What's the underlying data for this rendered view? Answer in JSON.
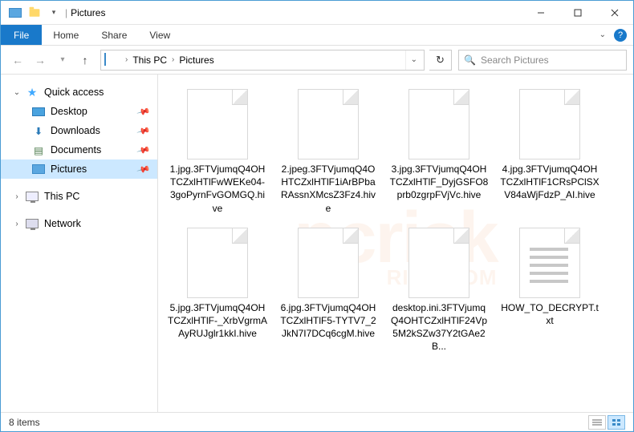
{
  "titlebar": {
    "title": "Pictures"
  },
  "menu": {
    "file": "File",
    "home": "Home",
    "share": "Share",
    "view": "View"
  },
  "breadcrumb": {
    "seg1": "This PC",
    "seg2": "Pictures"
  },
  "search": {
    "placeholder": "Search Pictures"
  },
  "sidebar": {
    "quick_access": "Quick access",
    "desktop": "Desktop",
    "downloads": "Downloads",
    "documents": "Documents",
    "pictures": "Pictures",
    "this_pc": "This PC",
    "network": "Network"
  },
  "files": {
    "f1": "1.jpg.3FTVjumqQ4OHTCZxlHTlFwWEKe04-3goPyrnFvGOMGQ.hive",
    "f2": "2.jpeg.3FTVjumqQ4OHTCZxlHTlF1iArBPbaRAssnXMcsZ3Fz4.hive",
    "f3": "3.jpg.3FTVjumqQ4OHTCZxlHTlF_DyjGSFO8prb0zgrpFVjVc.hive",
    "f4": "4.jpg.3FTVjumqQ4OHTCZxlHTlF1CRsPClSXV84aWjFdzP_AI.hive",
    "f5": "5.jpg.3FTVjumqQ4OHTCZxlHTlF-_XrbVgrmAAyRUJglr1kkI.hive",
    "f6": "6.jpg.3FTVjumqQ4OHTCZxlHTlF5-TYTV7_2JkN7I7DCq6cgM.hive",
    "f7": "desktop.ini.3FTVjumqQ4OHTCZxlHTlF24Vp5M2kSZw37Y2tGAe2B...",
    "f8": "HOW_TO_DECRYPT.txt"
  },
  "statusbar": {
    "count": "8 items"
  },
  "watermark": {
    "main": "pcrisk",
    "sub": "RISK.COM"
  }
}
